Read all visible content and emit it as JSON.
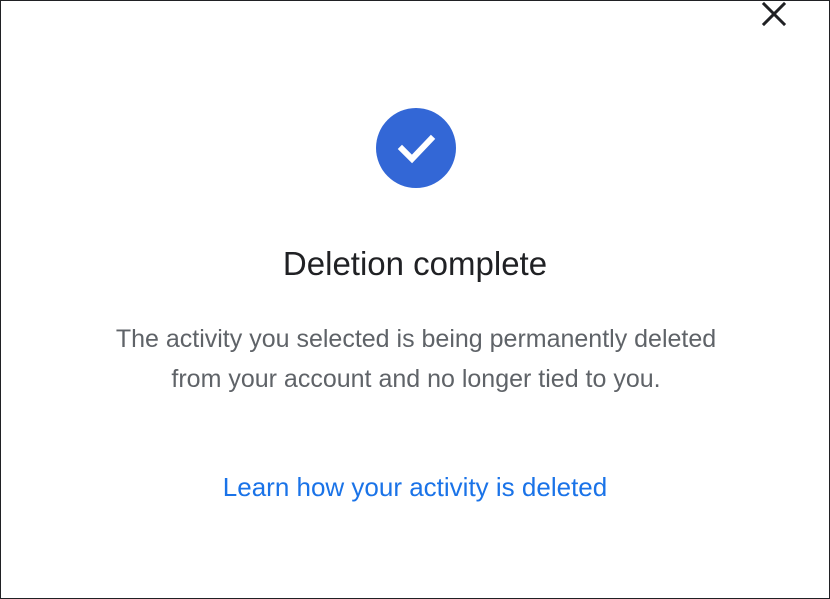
{
  "dialog": {
    "close_icon": "close-icon",
    "status_icon": "checkmark-circle-icon",
    "title": "Deletion complete",
    "message": "The activity you selected is being permanently deleted from your account and no longer tied to you.",
    "link_text": "Learn how your activity is deleted"
  },
  "colors": {
    "accent": "#3367d6",
    "link": "#1a73e8",
    "title_text": "#202124",
    "body_text": "#5f6368"
  }
}
